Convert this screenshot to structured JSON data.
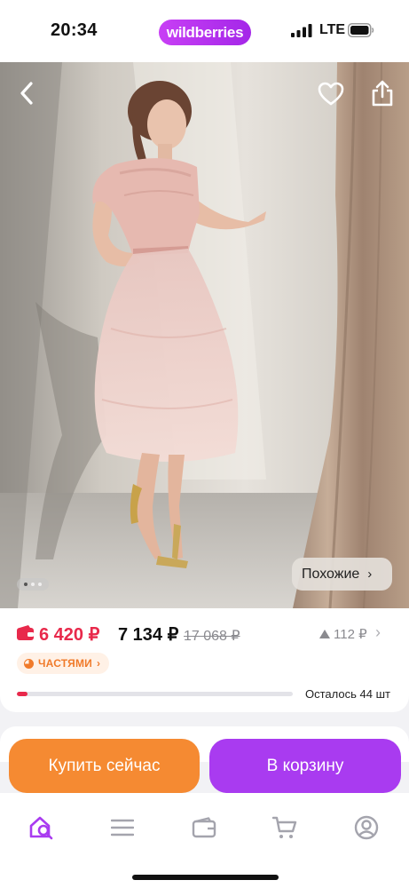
{
  "status_bar": {
    "time": "20:34",
    "brand": "wildberries",
    "network": "LTE"
  },
  "photo": {
    "similar_label": "Похожие",
    "similar_chevron": "›",
    "icons": [
      "back-arrow-icon",
      "heart-icon",
      "share-icon"
    ],
    "page_count": 3,
    "active_page": 1
  },
  "price": {
    "wallet_price": "6 420 ₽",
    "current_price": "7 134 ₽",
    "old_price": "17 068 ₽",
    "rating_count": "112 ₽",
    "installment_label": "ЧАСТЯМИ",
    "installment_chevron": "›",
    "stock_text": "Осталось 44 шт",
    "stock_level": 0.04
  },
  "actions": {
    "buy_now": "Купить сейчас",
    "add_to_cart": "В корзину"
  },
  "tabbar": {
    "items": [
      "home-search-icon",
      "menu-icon",
      "wallet-icon",
      "cart-icon",
      "profile-icon"
    ]
  },
  "colors": {
    "brand": "#a93bf0",
    "buy": "#f58a32",
    "sale": "#e8294b",
    "installment": "#f07a2a"
  }
}
